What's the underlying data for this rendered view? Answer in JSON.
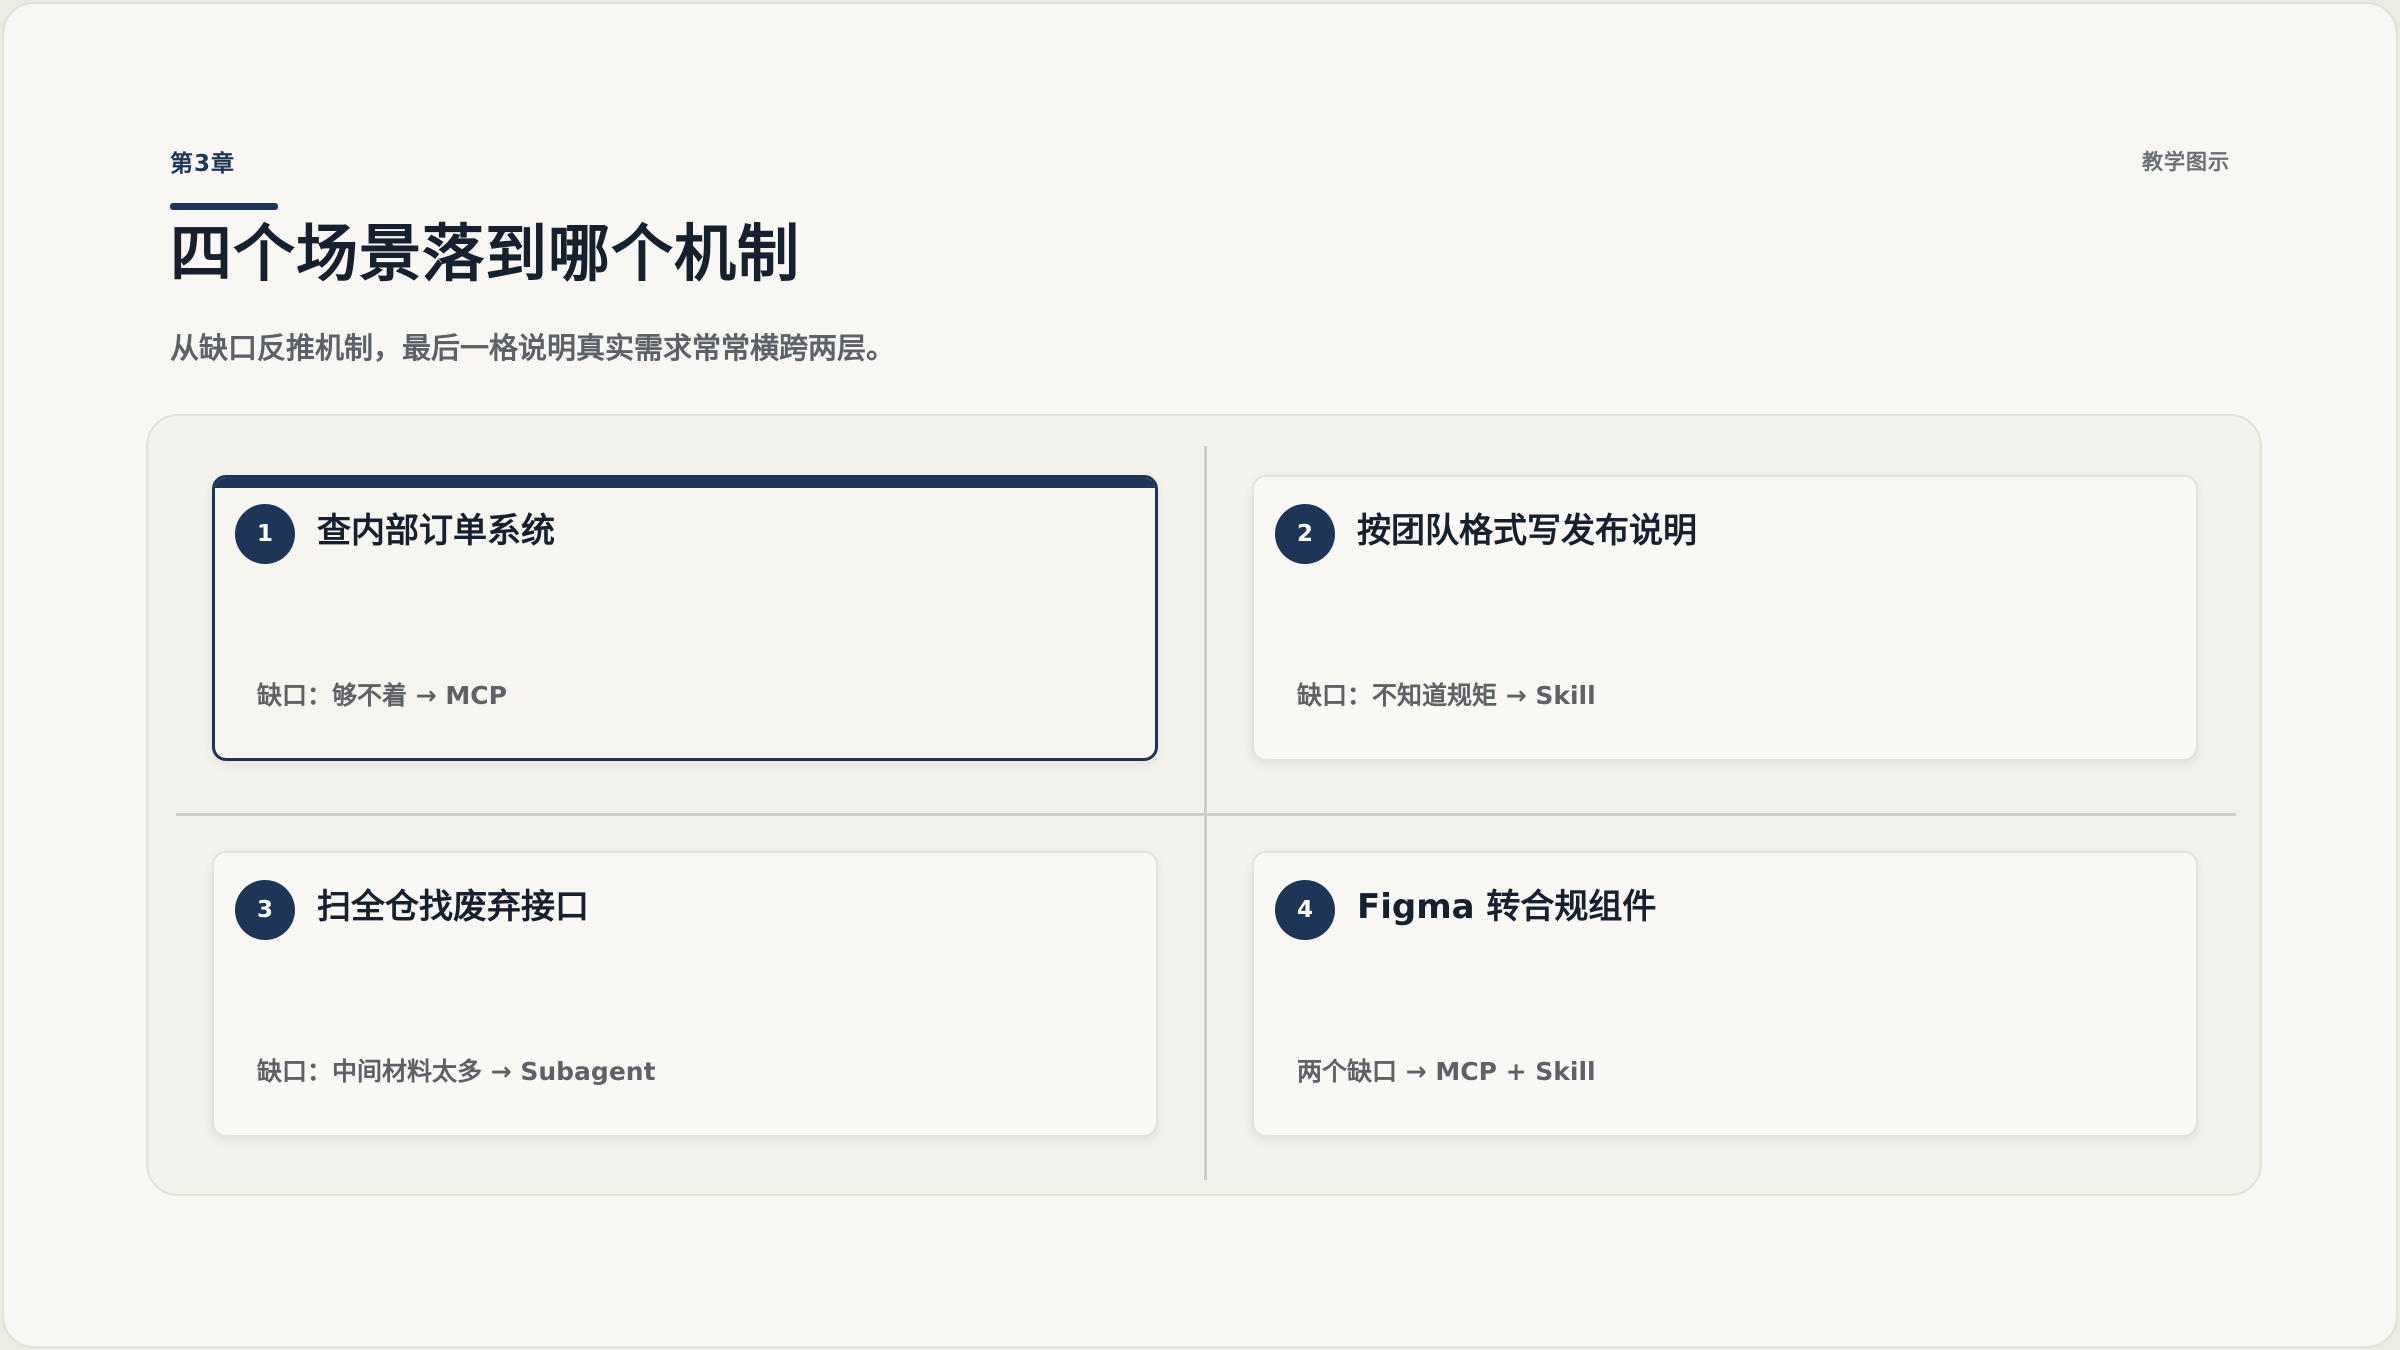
{
  "chapter": "第3章",
  "tag": "教学图示",
  "title": "四个场景落到哪个机制",
  "subtitle": "从缺口反推机制，最后一格说明真实需求常常横跨两层。",
  "cards": [
    {
      "number": "1",
      "title": "查内部订单系统",
      "gap": "缺口：够不着 → MCP",
      "highlighted": true
    },
    {
      "number": "2",
      "title": "按团队格式写发布说明",
      "gap": "缺口：不知道规矩 → Skill",
      "highlighted": false
    },
    {
      "number": "3",
      "title": "扫全仓找废弃接口",
      "gap": "缺口：中间材料太多 → Subagent",
      "highlighted": false
    },
    {
      "number": "4",
      "title": "Figma 转合规组件",
      "gap": "两个缺口 → MCP + Skill",
      "highlighted": false
    }
  ],
  "colors": {
    "accent": "#1d3557",
    "background": "#f8f7f3",
    "panel": "#f2f1eb"
  }
}
